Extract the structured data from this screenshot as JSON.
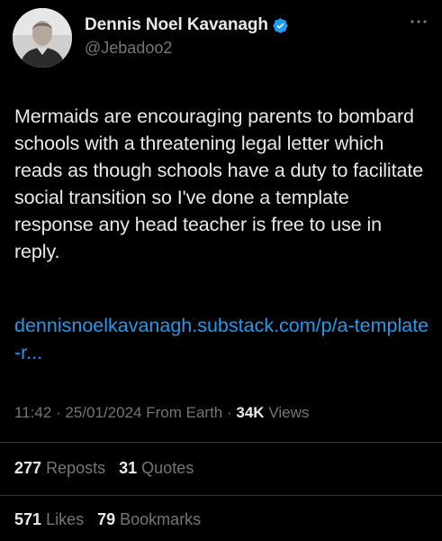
{
  "author": {
    "display_name": "Dennis Noel Kavanagh",
    "handle": "@Jebadoo2",
    "verified": true,
    "verified_color": "#1d9bf0",
    "avatar_icon": "profile-photo"
  },
  "more_icon": "ellipsis-icon",
  "tweet": {
    "text": "Mermaids are encouraging parents to bombard schools with a threatening legal letter which reads as though schools have a duty to facilitate social transition so I've done a template response any head teacher is free to use in reply.",
    "link": "dennisnoelkavanagh.substack.com/p/a-template-r..."
  },
  "meta": {
    "time": "11:42",
    "date": "25/01/2024",
    "source": "From Earth",
    "views_count": "34K",
    "views_label": "Views"
  },
  "stats": {
    "reposts_count": "277",
    "reposts_label": "Reposts",
    "quotes_count": "31",
    "quotes_label": "Quotes",
    "likes_count": "571",
    "likes_label": "Likes",
    "bookmarks_count": "79",
    "bookmarks_label": "Bookmarks"
  },
  "colors": {
    "background": "#000000",
    "text": "#e7e9ea",
    "secondary": "#71767b",
    "link": "#1d9bf0",
    "divider": "#2f3336"
  }
}
